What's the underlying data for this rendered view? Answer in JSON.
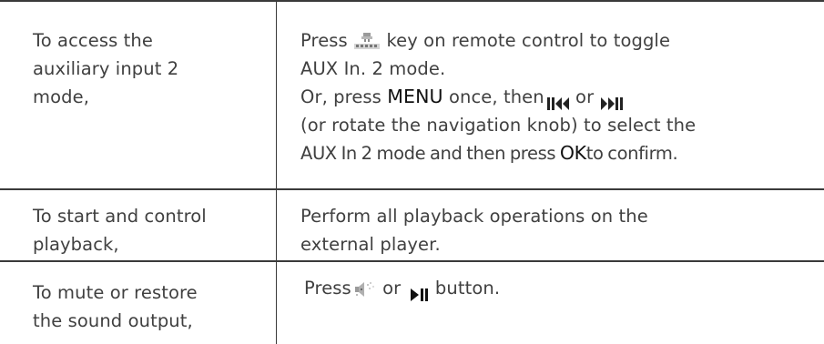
{
  "rows": [
    {
      "action": [
        "To access the",
        "auxiliary input 2",
        "mode,"
      ],
      "instructions": {
        "line1_before": "Press",
        "key_icon": "aux-in-key-icon",
        "line1_after": "key on remote control to toggle",
        "line2": "AUX In. 2 mode.",
        "line3_before": "Or, press",
        "menu_key": "MENU",
        "line3_mid": "once, then",
        "prev_icon": "pause-skip-back-icon",
        "line3_or": "or",
        "next_icon": "skip-forward-pause-icon",
        "line4": "(or rotate the navigation knob) to select the",
        "line5_before": "AUX In 2 mode and then press",
        "ok_key": "OK",
        "line5_after": "to confirm."
      }
    },
    {
      "action": [
        "To start and control",
        "playback,"
      ],
      "instructions": {
        "line1": "Perform all playback operations on the",
        "line2": "external player."
      }
    },
    {
      "action": [
        "To mute or restore",
        "the sound output,"
      ],
      "instructions": {
        "before": "Press",
        "mute_icon": "mute-speaker-icon",
        "or": "or",
        "play_icon": "play-pause-icon",
        "after": "button."
      }
    }
  ]
}
